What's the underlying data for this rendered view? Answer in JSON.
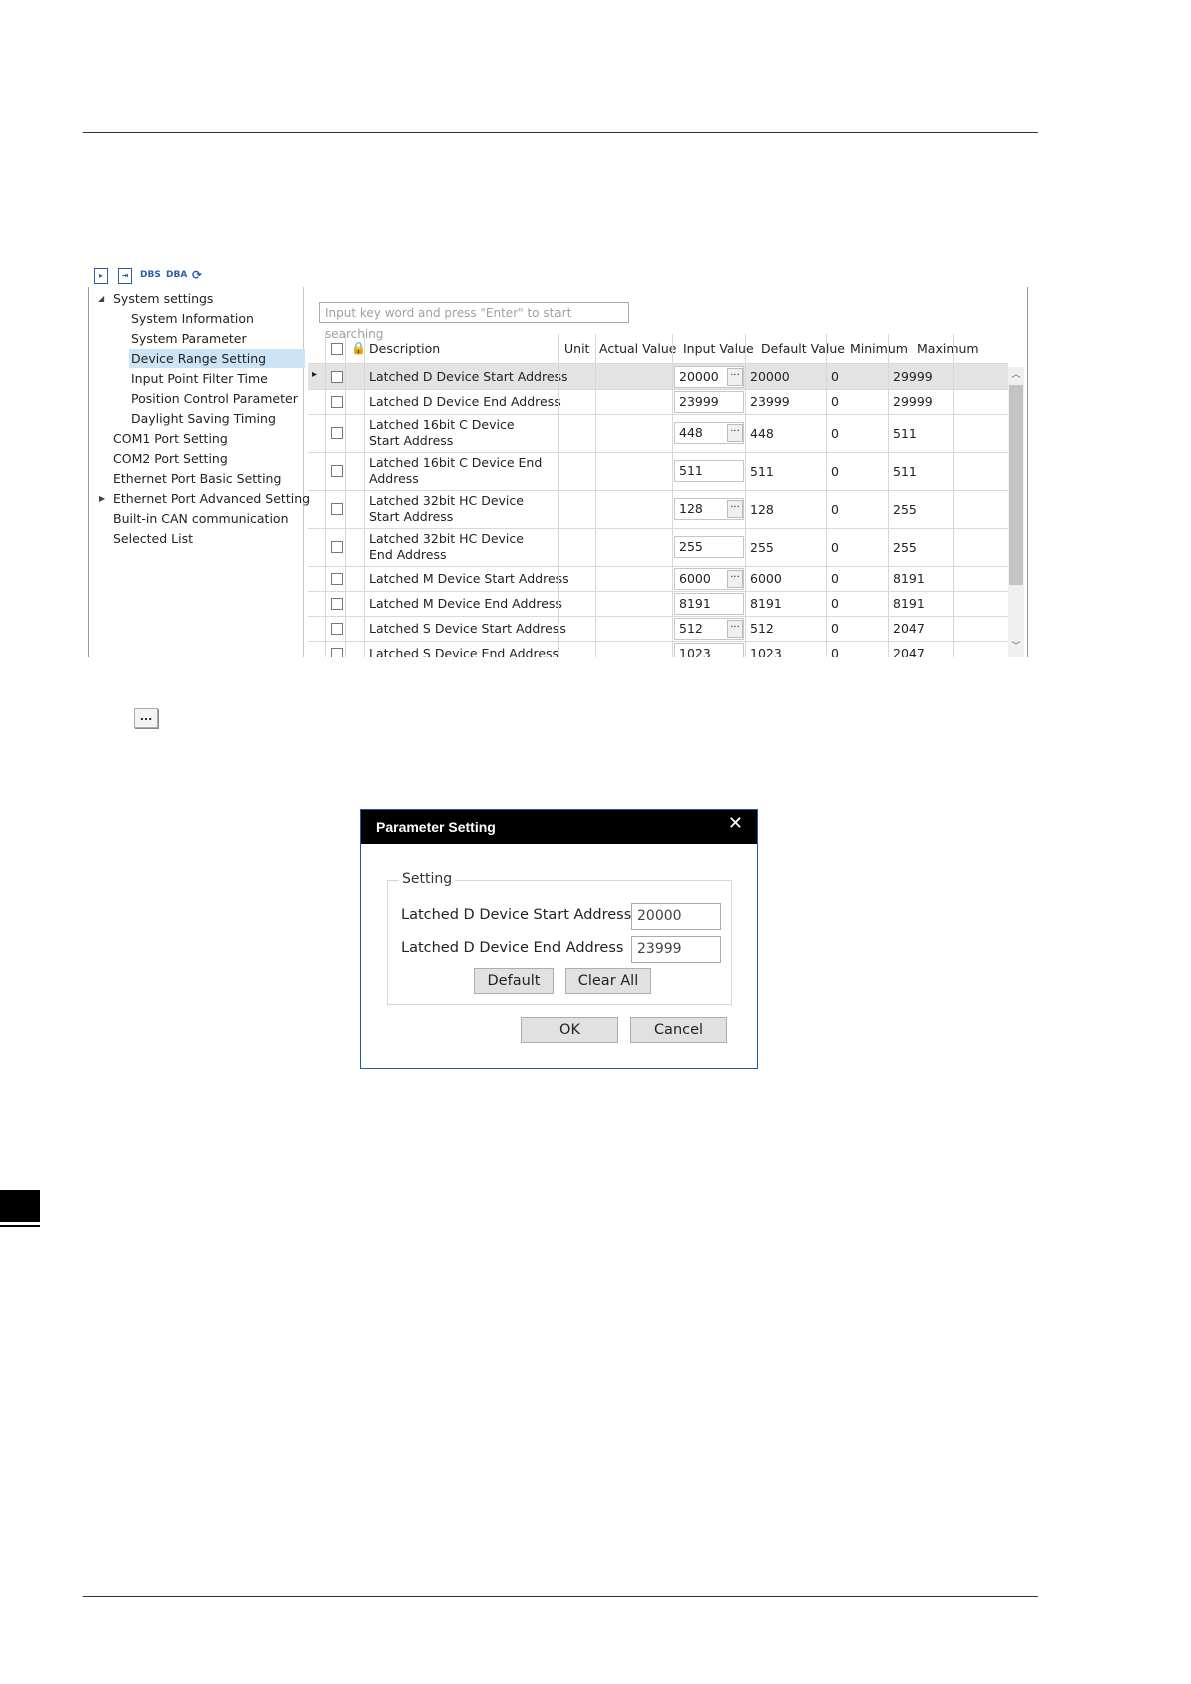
{
  "toolbar": {
    "icons": [
      "import-icon",
      "export-icon",
      "dbs-icon",
      "dba-icon",
      "refresh-icon"
    ],
    "dbs_label": "DBS",
    "dba_label": "DBA"
  },
  "tree": {
    "root": "System settings",
    "children": [
      "System Information",
      "System Parameter",
      "Device Range Setting",
      "Input Point Filter Time",
      "Position Control Parameter",
      "Daylight Saving Timing"
    ],
    "items": [
      "COM1 Port Setting",
      "COM2 Port Setting",
      "Ethernet Port Basic Setting",
      "Ethernet Port Advanced Setting",
      "Built-in CAN communication",
      "Selected List"
    ],
    "selected": "Device Range Setting"
  },
  "search": {
    "placeholder": "Input key word and press \"Enter\" to start searching"
  },
  "table": {
    "headers": {
      "description": "Description",
      "unit": "Unit",
      "actual_value": "Actual Value",
      "input_value": "Input Value",
      "default_value": "Default Value",
      "minimum": "Minimum",
      "maximum": "Maximum"
    },
    "rows": [
      {
        "description": "Latched D Device Start Address",
        "input": "20000",
        "default": "20000",
        "min": "0",
        "max": "29999"
      },
      {
        "description": "Latched D Device End Address",
        "input": "23999",
        "default": "23999",
        "min": "0",
        "max": "29999"
      },
      {
        "description": "Latched 16bit C Device Start Address",
        "input": "448",
        "default": "448",
        "min": "0",
        "max": "511"
      },
      {
        "description": "Latched 16bit C Device End Address",
        "input": "511",
        "default": "511",
        "min": "0",
        "max": "511"
      },
      {
        "description": "Latched 32bit HC Device Start Address",
        "input": "128",
        "default": "128",
        "min": "0",
        "max": "255"
      },
      {
        "description": "Latched 32bit HC Device End Address",
        "input": "255",
        "default": "255",
        "min": "0",
        "max": "255"
      },
      {
        "description": "Latched M Device Start Address",
        "input": "6000",
        "default": "6000",
        "min": "0",
        "max": "8191"
      },
      {
        "description": "Latched M Device End Address",
        "input": "8191",
        "default": "8191",
        "min": "0",
        "max": "8191"
      },
      {
        "description": "Latched S Device Start Address",
        "input": "512",
        "default": "512",
        "min": "0",
        "max": "2047"
      },
      {
        "description": "Latched S Device End Address",
        "input": "1023",
        "default": "1023",
        "min": "0",
        "max": "2047"
      }
    ]
  },
  "ellipsis_button": "...",
  "dialog": {
    "title": "Parameter Setting",
    "close": "✕",
    "group_label": "Setting",
    "start_label": "Latched D Device Start Address",
    "start_value": "20000",
    "end_label": "Latched D Device End Address",
    "end_value": "23999",
    "default_button": "Default",
    "clear_button": "Clear All",
    "ok_button": "OK",
    "cancel_button": "Cancel"
  }
}
